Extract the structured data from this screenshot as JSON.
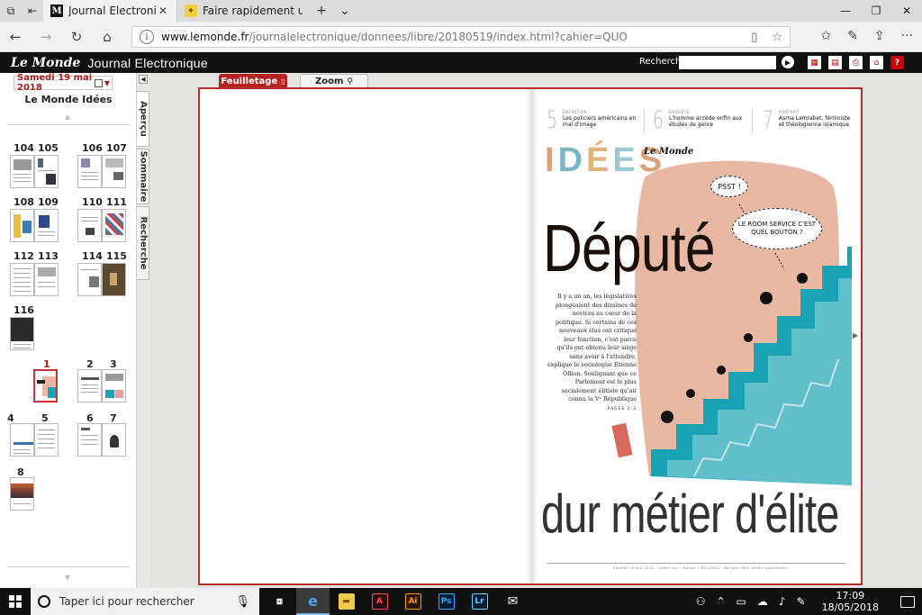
{
  "browser": {
    "tabs": [
      {
        "label": "Journal Electronique",
        "favicon": "le-monde-icon",
        "active": true
      },
      {
        "label": "Faire rapidement une captu",
        "favicon": "camera-icon",
        "active": false
      }
    ],
    "url_domain": "www.lemonde.fr",
    "url_path": "/journalelectronique/donnees/libre/20180519/index.html?cahier=QUO"
  },
  "journal": {
    "logo": "Le Monde",
    "title": "Journal Electronique",
    "search_label": "Recherche",
    "search_value": ""
  },
  "sidebar": {
    "date": "Samedi 19 mai 2018",
    "section": "Le Monde Idées",
    "tabs": [
      "Aperçu",
      "Sommaire",
      "Recherche"
    ],
    "upper_pages": [
      "104",
      "105",
      "106",
      "107",
      "108",
      "109",
      "110",
      "111",
      "112",
      "113",
      "114",
      "115",
      "116"
    ],
    "lower_pages": [
      "1",
      "2",
      "3",
      "4",
      "5",
      "6",
      "7",
      "8"
    ],
    "current_page": "1"
  },
  "viewer": {
    "mode_tabs": [
      "Feuilletage",
      "Zoom"
    ],
    "active_mode": "Feuilletage"
  },
  "page": {
    "teasers": [
      {
        "num": "5",
        "kicker": "ENTRETIEN",
        "text": "Les policiers américains en mal d'image"
      },
      {
        "num": "6",
        "kicker": "ENQUÊTE",
        "text": "L'homme accède enfin aux études de genre"
      },
      {
        "num": "7",
        "kicker": "PORTRAIT",
        "text": "Asma Lamrabet, féministe et théologienne islamique"
      }
    ],
    "section_letters": [
      "I",
      "D",
      "É",
      "E",
      "S"
    ],
    "section_brand": "Le Monde",
    "headline": "Député",
    "chapo": "Il y a un an, les législatives plongeaient des dizaines de novices au cœur de la politique. Si certains de ces nouveaux élus ont critiqué leur fonction, c'est parce qu'ils ont obtenu leur siège sans avoir à l'attendre, explique le sociologue Etienne Ollion. Soulignant que ce Parlement est le plus socialement élitiste qu'ait connu la Vᵉ République",
    "pages_ref": "PAGES 2-3",
    "subhead": "dur métier d'élite",
    "bubble_1": "PSST !",
    "bubble_2": "LE ROOM SERVICE C'EST QUEL BOUTON ?",
    "footer": "Samedi 19 mai 2018 · Cahier du « Monde » No 22814 · Ne peut être vendu séparément"
  },
  "taskbar": {
    "search_placeholder": "Taper ici pour rechercher",
    "apps": [
      "task-view",
      "edge",
      "explorer",
      "acrobat",
      "illustrator",
      "photoshop",
      "lightroom",
      "mail"
    ],
    "time": "17:09",
    "date": "18/05/2018"
  },
  "colors": {
    "accent_red": "#b82121",
    "header_black": "#111111",
    "illustration_salmon": "#e9b8a2",
    "illustration_teal": "#1aa3b4"
  }
}
